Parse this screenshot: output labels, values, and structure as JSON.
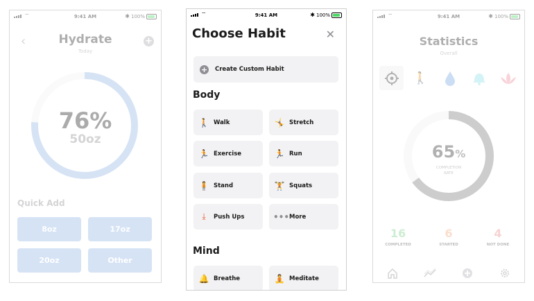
{
  "status": {
    "time": "9:41 AM",
    "battery": "100%"
  },
  "hydrate": {
    "title": "Hydrate",
    "subtitle": "Today",
    "percent": "76%",
    "percent_value": 0.76,
    "amount": "50oz",
    "quick_add_title": "Quick Add",
    "buttons": [
      "8oz",
      "17oz",
      "20oz",
      "Other"
    ],
    "ring_color": "#93b6e4"
  },
  "choose": {
    "title": "Choose Habit",
    "create_label": "Create Custom Habit",
    "sections": [
      "Body",
      "Mind"
    ],
    "body_habits": [
      {
        "label": "Walk",
        "icon": "walk-icon"
      },
      {
        "label": "Stretch",
        "icon": "stretch-icon"
      },
      {
        "label": "Exercise",
        "icon": "exercise-icon"
      },
      {
        "label": "Run",
        "icon": "run-icon"
      },
      {
        "label": "Stand",
        "icon": "stand-icon"
      },
      {
        "label": "Squats",
        "icon": "squats-icon"
      },
      {
        "label": "Push Ups",
        "icon": "push-ups-icon"
      },
      {
        "label": "More",
        "icon": "more-icon"
      }
    ],
    "mind_habits": [
      {
        "label": "Breathe",
        "icon": "breathe-icon"
      },
      {
        "label": "Meditate",
        "icon": "meditate-icon"
      }
    ]
  },
  "statistics": {
    "title": "Statistics",
    "subtitle": "Overall",
    "categories": [
      "target-icon",
      "walk-icon",
      "water-drop-icon",
      "bell-icon",
      "lotus-icon"
    ],
    "rate_value": "65",
    "rate_unit": "%",
    "rate_fraction": 0.65,
    "rate_label_1": "COMPLETION",
    "rate_label_2": "RATE",
    "stats": [
      {
        "value": "16",
        "label": "COMPLETED",
        "color": "#7ccf86"
      },
      {
        "value": "6",
        "label": "STARTED",
        "color": "#f2a87c"
      },
      {
        "value": "4",
        "label": "NOT DONE",
        "color": "#e98a8a"
      }
    ],
    "tabs": [
      "home-icon",
      "trend-icon",
      "add-icon",
      "settings-icon"
    ]
  }
}
